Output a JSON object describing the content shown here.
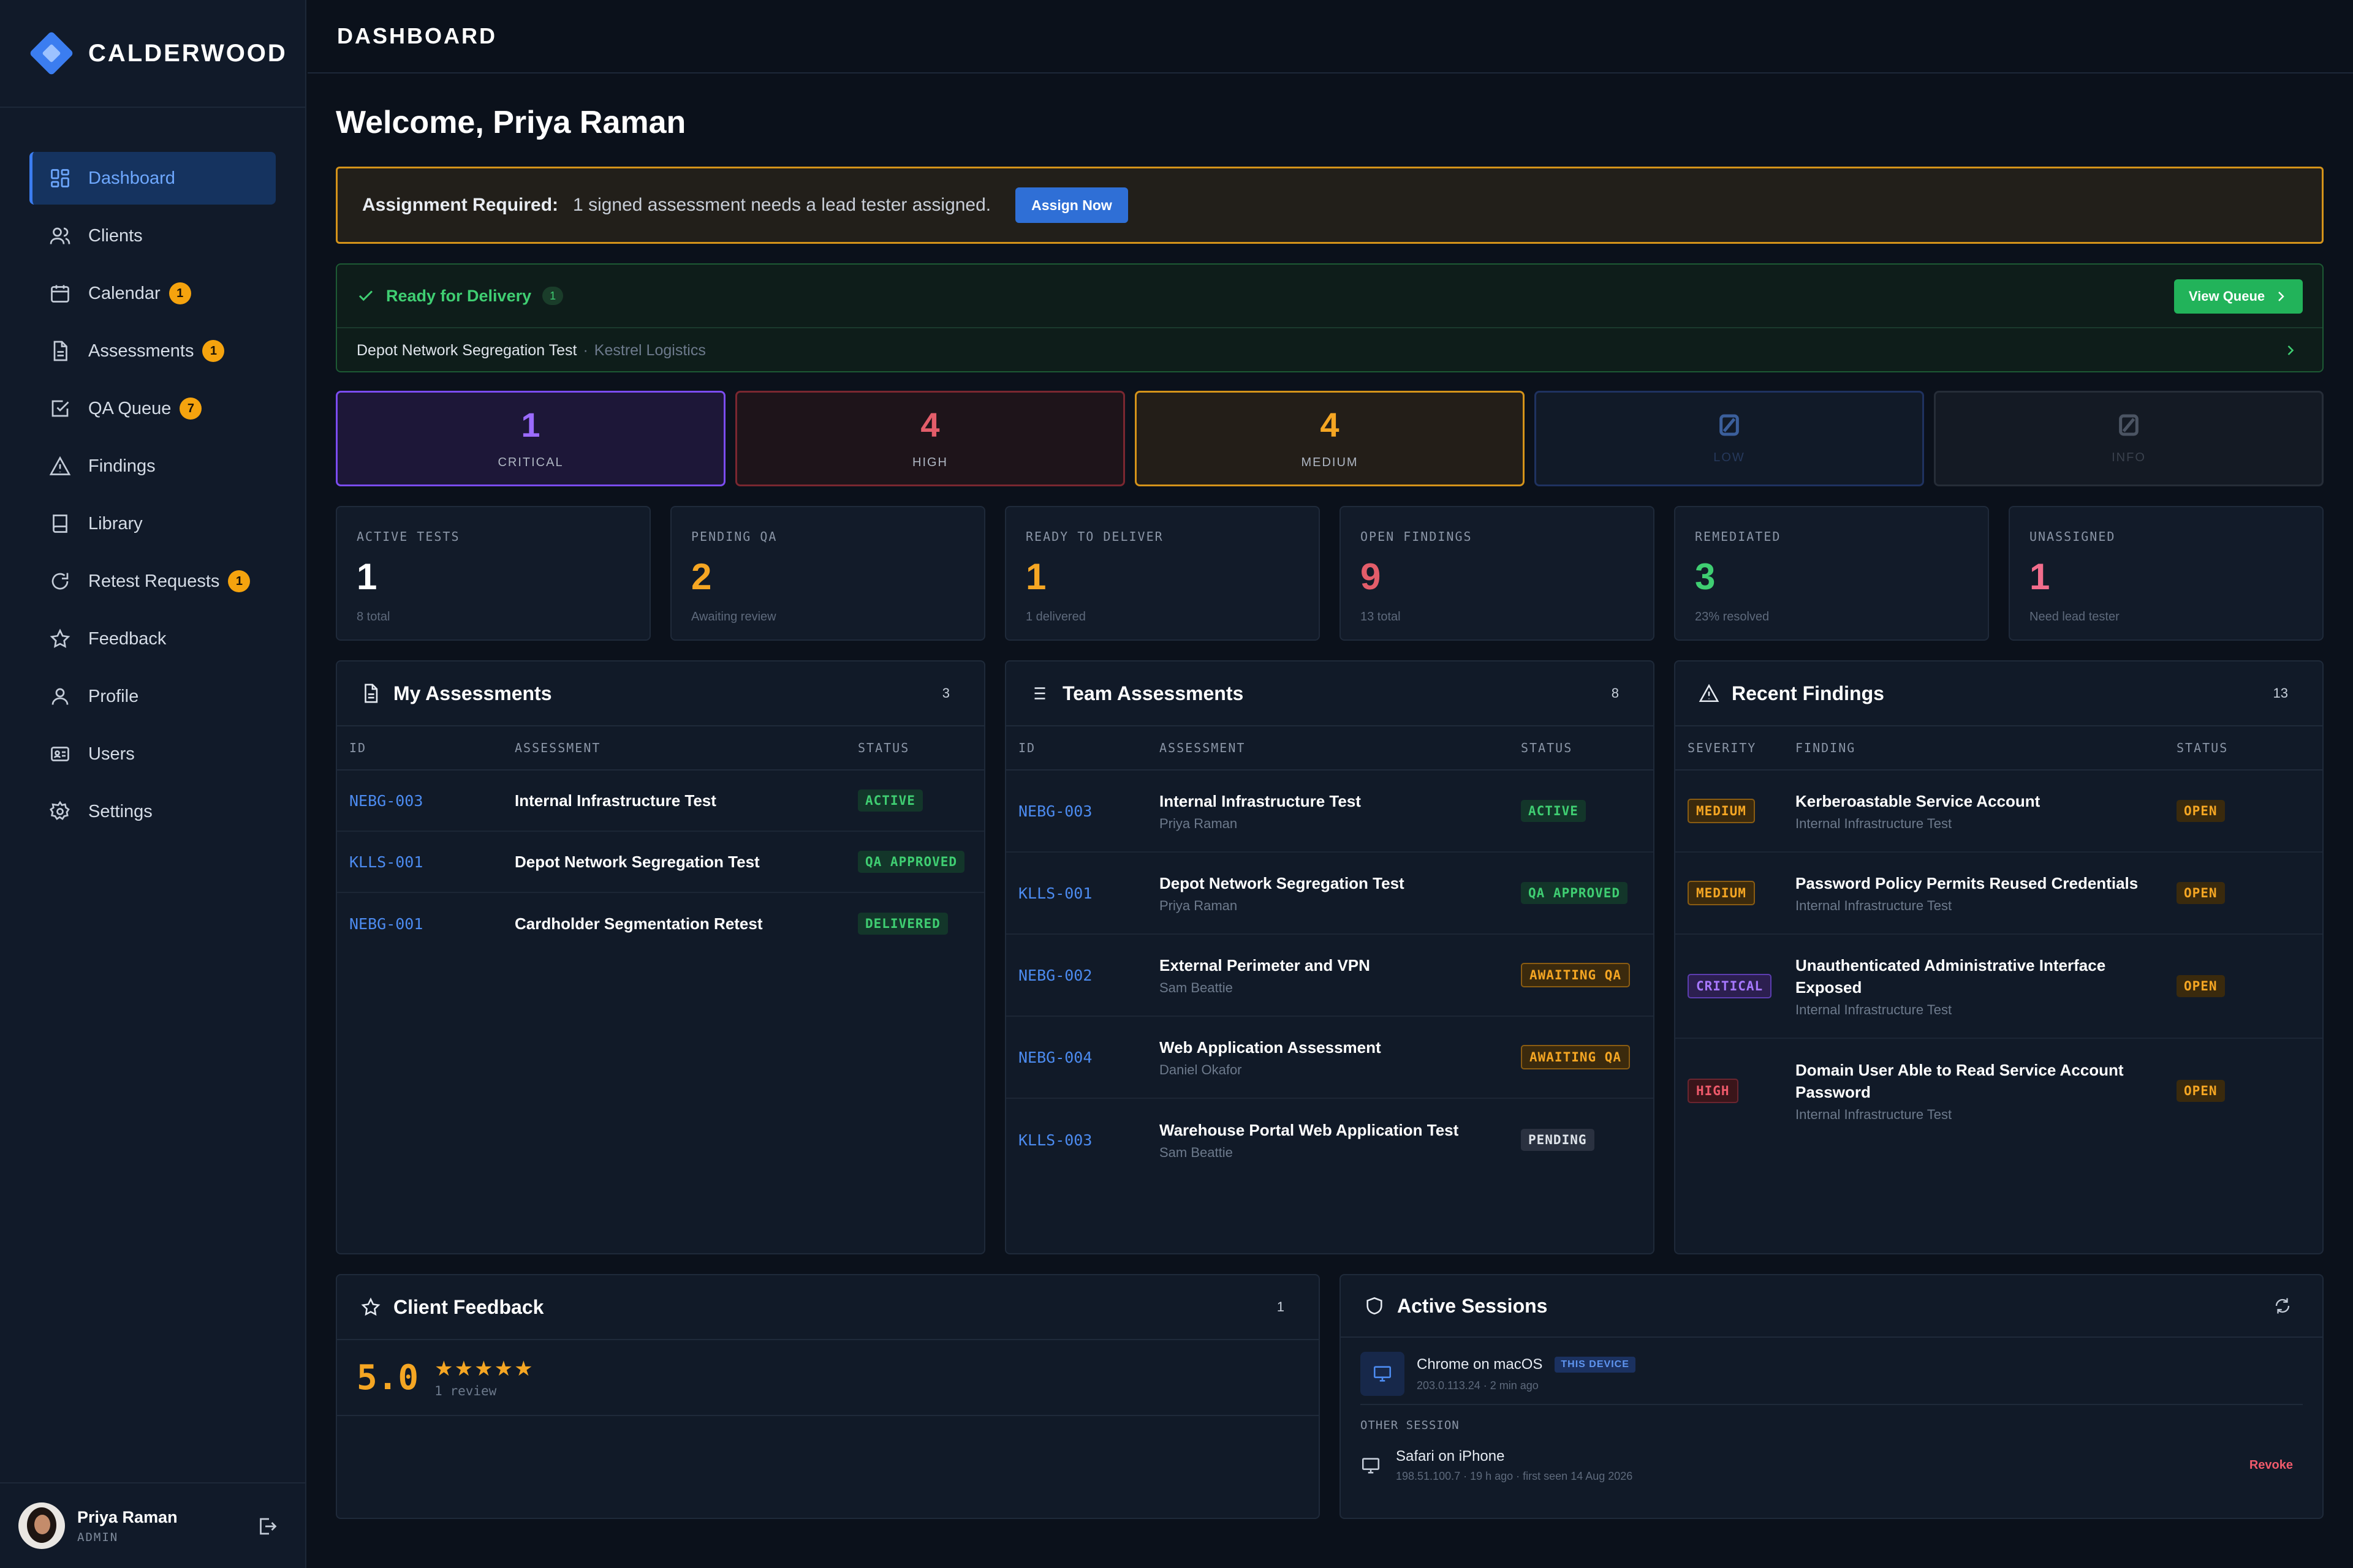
{
  "brand": {
    "name": "CALDERWOOD"
  },
  "sidebar": {
    "items": [
      {
        "label": "Dashboard",
        "icon": "dashboard-icon",
        "active": true
      },
      {
        "label": "Clients",
        "icon": "users-icon"
      },
      {
        "label": "Calendar",
        "icon": "calendar-icon",
        "badge": "1"
      },
      {
        "label": "Assessments",
        "icon": "document-icon",
        "badge": "1"
      },
      {
        "label": "QA Queue",
        "icon": "checkbox-icon",
        "badge": "7"
      },
      {
        "label": "Findings",
        "icon": "warning-icon"
      },
      {
        "label": "Library",
        "icon": "book-icon"
      },
      {
        "label": "Retest Requests",
        "icon": "refresh-icon",
        "badge": "1"
      },
      {
        "label": "Feedback",
        "icon": "star-icon"
      },
      {
        "label": "Profile",
        "icon": "user-icon"
      },
      {
        "label": "Users",
        "icon": "id-card-icon"
      },
      {
        "label": "Settings",
        "icon": "gear-icon"
      }
    ]
  },
  "user": {
    "name": "Priya Raman",
    "role": "ADMIN"
  },
  "header": {
    "title": "DASHBOARD"
  },
  "welcome": "Welcome, Priya Raman",
  "alert": {
    "title": "Assignment Required:",
    "message": "1 signed assessment needs a lead tester assigned.",
    "button": "Assign Now"
  },
  "ready": {
    "label": "Ready for Delivery",
    "count": "1",
    "button": "View Queue",
    "item": {
      "name": "Depot Network Segregation Test",
      "sep": "·",
      "client": "Kestrel Logistics"
    }
  },
  "severity": [
    {
      "label": "CRITICAL",
      "value": "1",
      "color": "#9b6bff",
      "bg": "#1d1738",
      "border": "#7b4cf0"
    },
    {
      "label": "HIGH",
      "value": "4",
      "color": "#e35d6a",
      "bg": "#1e141a",
      "border": "#7a2730"
    },
    {
      "label": "MEDIUM",
      "value": "4",
      "color": "#f5a623",
      "bg": "#231e18",
      "border": "#d4931a"
    },
    {
      "label": "LOW",
      "value": "",
      "color": "#3b5f9c",
      "bg": "#111a28",
      "border": "#1f3260"
    },
    {
      "label": "INFO",
      "value": "",
      "color": "#4b5463",
      "bg": "#141a24",
      "border": "#262d38"
    }
  ],
  "stats": [
    {
      "label": "ACTIVE TESTS",
      "value": "1",
      "sub": "8 total",
      "color": "#ffffff"
    },
    {
      "label": "PENDING QA",
      "value": "2",
      "sub": "Awaiting review",
      "color": "#f5a623"
    },
    {
      "label": "READY TO DELIVER",
      "value": "1",
      "sub": "1 delivered",
      "color": "#f5a623"
    },
    {
      "label": "OPEN FINDINGS",
      "value": "9",
      "sub": "13 total",
      "color": "#e35d6a"
    },
    {
      "label": "REMEDIATED",
      "value": "3",
      "sub": "23% resolved",
      "color": "#3fce72"
    },
    {
      "label": "UNASSIGNED",
      "value": "1",
      "sub": "Need lead tester",
      "color": "#f26d8c"
    }
  ],
  "my_assessments": {
    "title": "My Assessments",
    "count": "3",
    "columns": [
      "ID",
      "ASSESSMENT",
      "STATUS"
    ],
    "rows": [
      {
        "id": "NEBG-003",
        "name": "Internal Infrastructure Test",
        "status": "ACTIVE",
        "style": "green"
      },
      {
        "id": "KLLS-001",
        "name": "Depot Network Segregation Test",
        "status": "QA APPROVED",
        "style": "green"
      },
      {
        "id": "NEBG-001",
        "name": "Cardholder Segmentation Retest",
        "status": "DELIVERED",
        "style": "green"
      }
    ]
  },
  "team_assessments": {
    "title": "Team Assessments",
    "count": "8",
    "columns": [
      "ID",
      "ASSESSMENT",
      "STATUS"
    ],
    "rows": [
      {
        "id": "NEBG-003",
        "name": "Internal Infrastructure Test",
        "owner": "Priya Raman",
        "status": "ACTIVE",
        "style": "green"
      },
      {
        "id": "KLLS-001",
        "name": "Depot Network Segregation Test",
        "owner": "Priya Raman",
        "status": "QA APPROVED",
        "style": "green"
      },
      {
        "id": "NEBG-002",
        "name": "External Perimeter and VPN",
        "owner": "Sam Beattie",
        "status": "AWAITING QA",
        "style": "amber"
      },
      {
        "id": "NEBG-004",
        "name": "Web Application Assessment",
        "owner": "Daniel Okafor",
        "status": "AWAITING QA",
        "style": "amber"
      },
      {
        "id": "KLLS-003",
        "name": "Warehouse Portal Web Application Test",
        "owner": "Sam Beattie",
        "status": "PENDING",
        "style": "grey"
      }
    ]
  },
  "recent_findings": {
    "title": "Recent Findings",
    "count": "13",
    "columns": [
      "SEVERITY",
      "FINDING",
      "STATUS"
    ],
    "rows": [
      {
        "severity": "MEDIUM",
        "style": "amber",
        "line1": "Kerberoastable Service Account",
        "line2": "",
        "test": "Internal Infrastructure Test",
        "status": "OPEN"
      },
      {
        "severity": "MEDIUM",
        "style": "amber",
        "line1": "Password Policy Permits Reused Credentials",
        "line2": "",
        "test": "Internal Infrastructure Test",
        "status": "OPEN"
      },
      {
        "severity": "CRITICAL",
        "style": "purple",
        "line1": "Unauthenticated Administrative Interface",
        "line2": "Exposed",
        "test": "Internal Infrastructure Test",
        "status": "OPEN"
      },
      {
        "severity": "HIGH",
        "style": "red",
        "line1": "Domain User Able to Read Service Account",
        "line2": "Password",
        "test": "Internal Infrastructure Test",
        "status": "OPEN"
      }
    ]
  },
  "feedback": {
    "title": "Client Feedback",
    "count": "1",
    "score": "5.0",
    "stars": "★★★★★",
    "reviews": "1 review"
  },
  "sessions": {
    "title": "Active Sessions",
    "current": {
      "name": "Chrome on macOS",
      "tag": "THIS DEVICE",
      "meta": "203.0.113.24 · 2 min ago"
    },
    "other_label": "OTHER SESSION",
    "other": {
      "name": "Safari on iPhone",
      "meta": "198.51.100.7 · 19 h ago · first seen 14 Aug 2026",
      "action": "Revoke"
    }
  }
}
